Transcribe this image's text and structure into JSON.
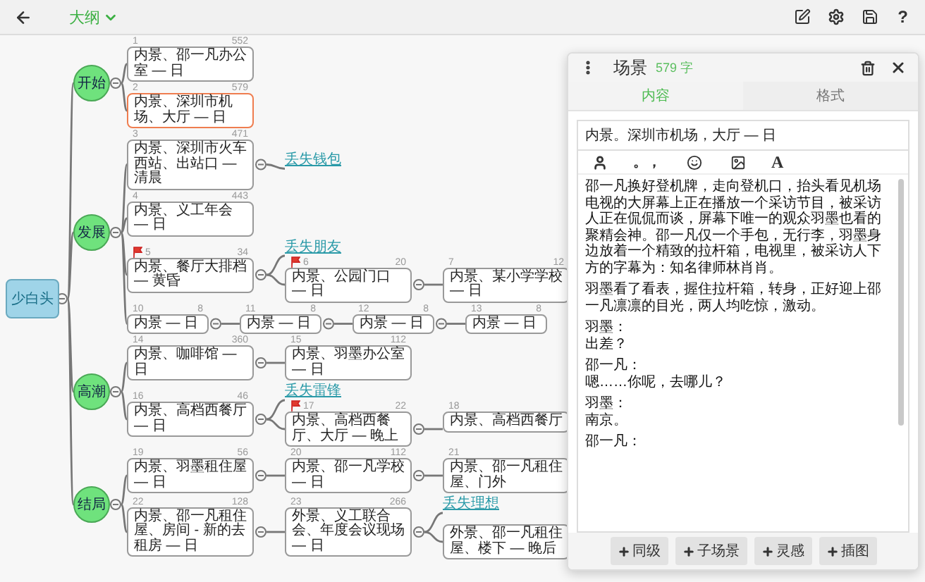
{
  "toolbar": {
    "view_label": "大纲",
    "help_label": "?"
  },
  "outline": {
    "root": "少白头",
    "chapters": [
      {
        "title": "开始",
        "scenes": [
          {
            "kind": "scene",
            "index": "1",
            "words": "552",
            "heading": "内景、邵一凡办公室 — 日",
            "flagged": false,
            "selected": false
          },
          {
            "kind": "scene",
            "index": "2",
            "words": "579",
            "heading": "内景、深圳市机场、大厅 — 日",
            "flagged": false,
            "selected": true
          }
        ]
      },
      {
        "title": "发展",
        "scenes": [
          {
            "kind": "scene",
            "index": "3",
            "words": "471",
            "heading": "内景、深圳市火车西站、出站口 — 清晨",
            "flagged": false,
            "selected": false,
            "children": [
              {
                "kind": "idea",
                "title": "丢失钱包"
              }
            ]
          },
          {
            "kind": "scene",
            "index": "4",
            "words": "443",
            "heading": "内景、义工年会 — 日",
            "flagged": false,
            "selected": false
          },
          {
            "kind": "scene",
            "index": "5",
            "words": "34",
            "heading": "内景、餐厅大排档 — 黄昏",
            "flagged": true,
            "selected": false,
            "children": [
              {
                "kind": "idea",
                "title": "丢失朋友"
              },
              {
                "kind": "scene",
                "index": "6",
                "words": "20",
                "heading": "内景、公园门口 — 日",
                "flagged": true,
                "selected": false,
                "children": [
                  {
                    "kind": "scene",
                    "index": "7",
                    "words": "12",
                    "heading": "内景、某小学学校 — 日",
                    "flagged": false,
                    "selected": false
                  }
                ]
              }
            ]
          },
          {
            "kind": "scene",
            "index": "10",
            "words": "8",
            "heading": "内景 — 日",
            "flagged": false,
            "selected": false,
            "children": [
              {
                "kind": "scene",
                "index": "11",
                "words": "8",
                "heading": "内景 — 日",
                "flagged": false,
                "selected": false,
                "children": [
                  {
                    "kind": "scene",
                    "index": "12",
                    "words": "8",
                    "heading": "内景 — 日",
                    "flagged": false,
                    "selected": false,
                    "children": [
                      {
                        "kind": "scene",
                        "index": "13",
                        "words": "8",
                        "heading": "内景 — 日",
                        "flagged": false,
                        "selected": false
                      }
                    ]
                  }
                ]
              }
            ]
          }
        ]
      },
      {
        "title": "高潮",
        "scenes": [
          {
            "kind": "scene",
            "index": "14",
            "words": "360",
            "heading": "内景、咖啡馆 — 日",
            "flagged": false,
            "selected": false,
            "children": [
              {
                "kind": "scene",
                "index": "15",
                "words": "112",
                "heading": "内景、羽墨办公室 — 日",
                "flagged": false,
                "selected": false
              }
            ]
          },
          {
            "kind": "scene",
            "index": "16",
            "words": "46",
            "heading": "内景、高档西餐厅 — 日",
            "flagged": false,
            "selected": false,
            "children": [
              {
                "kind": "idea",
                "title": "丢失雷锋"
              },
              {
                "kind": "scene",
                "index": "17",
                "words": "22",
                "heading": "内景、高档西餐厅、大厅 — 晚上",
                "flagged": true,
                "selected": false,
                "children": [
                  {
                    "kind": "scene",
                    "index": "18",
                    "heading": "内景、高档西餐厅",
                    "flagged": false,
                    "selected": false
                  }
                ]
              }
            ]
          }
        ]
      },
      {
        "title": "结局",
        "scenes": [
          {
            "kind": "scene",
            "index": "19",
            "words": "56",
            "heading": "内景、羽墨租住屋 — 日",
            "flagged": false,
            "selected": false,
            "children": [
              {
                "kind": "scene",
                "index": "20",
                "words": "112",
                "heading": "内景、邵一凡学校 — 日",
                "flagged": false,
                "selected": false,
                "children": [
                  {
                    "kind": "scene",
                    "index": "21",
                    "heading": "内景、邵一凡租住屋、门外",
                    "flagged": false,
                    "selected": false
                  }
                ]
              }
            ]
          },
          {
            "kind": "scene",
            "index": "22",
            "words": "128",
            "heading": "内景、邵一凡租住屋、房间 - 新的去租房 — 日",
            "flagged": false,
            "selected": false,
            "children": [
              {
                "kind": "scene",
                "index": "23",
                "words": "266",
                "heading": "外景、义工联合会、年度会议现场 — 日",
                "flagged": false,
                "selected": false,
                "children": [
                  {
                    "kind": "idea",
                    "title": "丢失理想"
                  },
                  {
                    "kind": "scene",
                    "heading": "外景、邵一凡租住屋、楼下 — 晚后",
                    "flagged": false,
                    "selected": false
                  }
                ]
              }
            ]
          }
        ]
      }
    ]
  },
  "panel": {
    "title": "场景",
    "word_count": "579 字",
    "tabs": [
      {
        "label": "内容",
        "selected": true
      },
      {
        "label": "格式",
        "selected": false
      }
    ],
    "heading_value": "内景。深圳市机场，大厅 — 日",
    "punctuation_label": "。，",
    "font_label": "A",
    "paragraphs": [
      [
        "邵一凡换好登机牌，走向登机口，抬头看见机场电视的大屏幕上正在播放一个采访节目，被采访人正在侃侃而谈，屏幕下唯一的观众羽墨也看的聚精会神。邵一凡仅一个手包，无行李，羽墨身边放着一个精致的拉杆箱，电视里，被采访人下方的字幕为：知名律师林肖肖。"
      ],
      [
        "羽墨看了看表，握住拉杆箱，转身，正好迎上邵一凡凛凛的目光，两人均吃惊，激动。"
      ],
      [
        "羽墨：",
        "出差？"
      ],
      [
        "邵一凡：",
        "嗯……你呢，去哪儿？"
      ],
      [
        "羽墨：",
        "南京。"
      ],
      [
        "邵一凡："
      ]
    ],
    "buttons": [
      "同级",
      "子场景",
      "灵感",
      "插图"
    ]
  }
}
